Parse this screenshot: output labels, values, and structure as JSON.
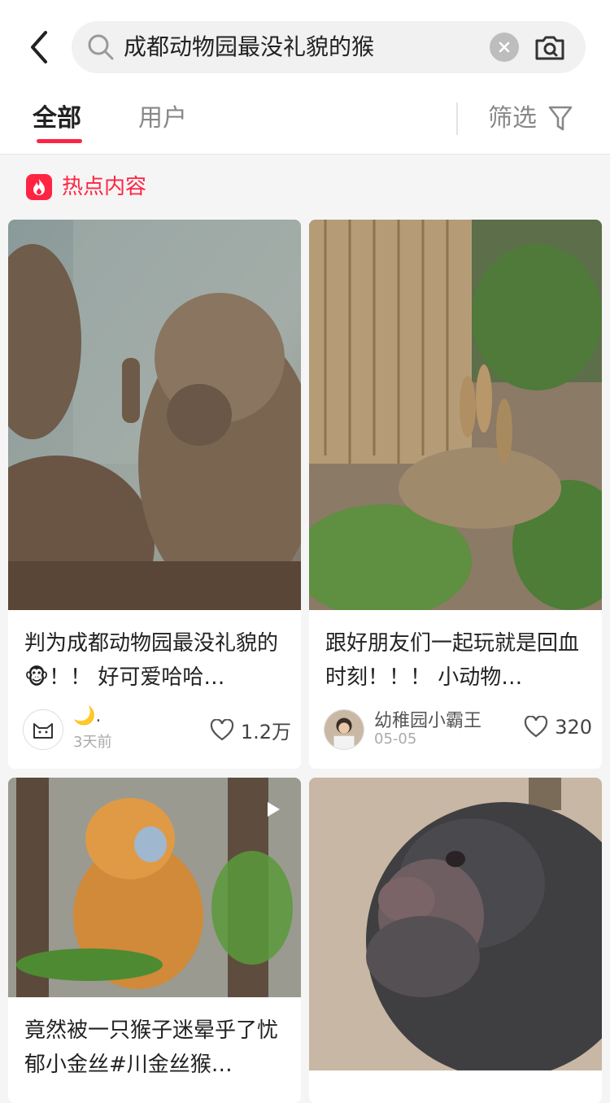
{
  "search": {
    "query": "成都动物园最没礼貌的猴"
  },
  "tabs": {
    "all": "全部",
    "user": "用户",
    "filter": "筛选"
  },
  "section": {
    "hot_label": "热点内容"
  },
  "cards": [
    {
      "title": "判为成都动物园最没礼貌的🐵！！ 好可爱哈哈…",
      "author": "🌙.",
      "date": "3天前",
      "likes": "1.2万"
    },
    {
      "title": "跟好朋友们一起玩就是回血时刻！！！ 小动物…",
      "author": "幼稚园小霸王",
      "date": "05-05",
      "likes": "320"
    },
    {
      "title": "竟然被一只猴子迷晕乎了忧郁小金丝#川金丝猴…",
      "is_video": true
    },
    {
      "title": ""
    }
  ],
  "colors": {
    "accent": "#ff2442",
    "page_bg": "#f5f5f5",
    "card_bg": "#ffffff"
  }
}
